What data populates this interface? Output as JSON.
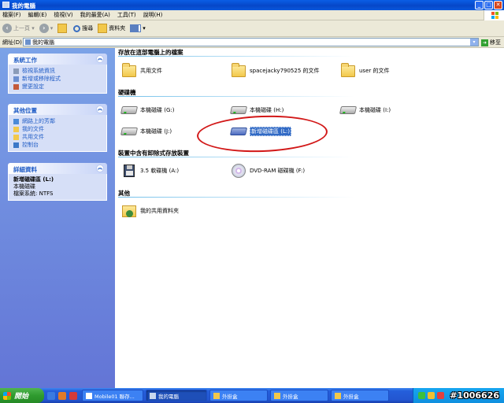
{
  "window": {
    "title": "我的電腦",
    "controls": [
      "minimize",
      "maximize",
      "close"
    ]
  },
  "menu": [
    "檔案(F)",
    "編輯(E)",
    "檢視(V)",
    "我的最愛(A)",
    "工具(T)",
    "說明(H)"
  ],
  "toolbar": {
    "back_label": "上一頁",
    "search_label": "搜尋",
    "folders_label": "資料夾"
  },
  "address": {
    "label": "網址(D)",
    "value": "我的電腦",
    "go_label": "移至"
  },
  "left_panel": {
    "system_tasks": {
      "title": "系統工作",
      "items": [
        "檢視系統資訊",
        "新增或移除程式",
        "變更設定"
      ]
    },
    "other_places": {
      "title": "其他位置",
      "items": [
        "網路上的芳鄰",
        "我的文件",
        "共用文件",
        "控制台"
      ]
    },
    "details": {
      "title": "詳細資料",
      "name": "新增磁碟區 (L:)",
      "type": "本機磁碟",
      "filesystem": "檔案系統: NTFS"
    }
  },
  "groups": {
    "stored": {
      "title": "存放在這部電腦上的檔案",
      "items": [
        "共用文件",
        "spacejacky790525 的文件",
        "user 的文件"
      ]
    },
    "hard_drives": {
      "title": "硬碟機",
      "items": [
        "本機磁碟 (G:)",
        "本機磁碟 (H:)",
        "本機磁碟 (I:)",
        "本機磁碟 (J:)",
        "新增磁碟區 (L:)"
      ],
      "selected": "新增磁碟區 (L:)"
    },
    "removable": {
      "title": "裝置中含有卸除式存放裝置",
      "items": [
        "3.5 軟碟機 (A:)",
        "DVD-RAM 磁碟機 (F:)"
      ]
    },
    "other": {
      "title": "其他",
      "items": [
        "我的共用資料夾"
      ]
    }
  },
  "taskbar": {
    "start_label": "開始",
    "tasks": [
      "Mobile01 聯存...",
      "我的電腦",
      "外掛盒",
      "外掛盒",
      "外掛盒"
    ],
    "active_task": "我的電腦"
  },
  "watermark": "#1006626",
  "colors": {
    "title_blue": "#0a5ee6",
    "taskbar_blue": "#245edb",
    "start_green": "#2f9b2f",
    "selection": "#316ac5",
    "annotation_red": "#d21818"
  }
}
